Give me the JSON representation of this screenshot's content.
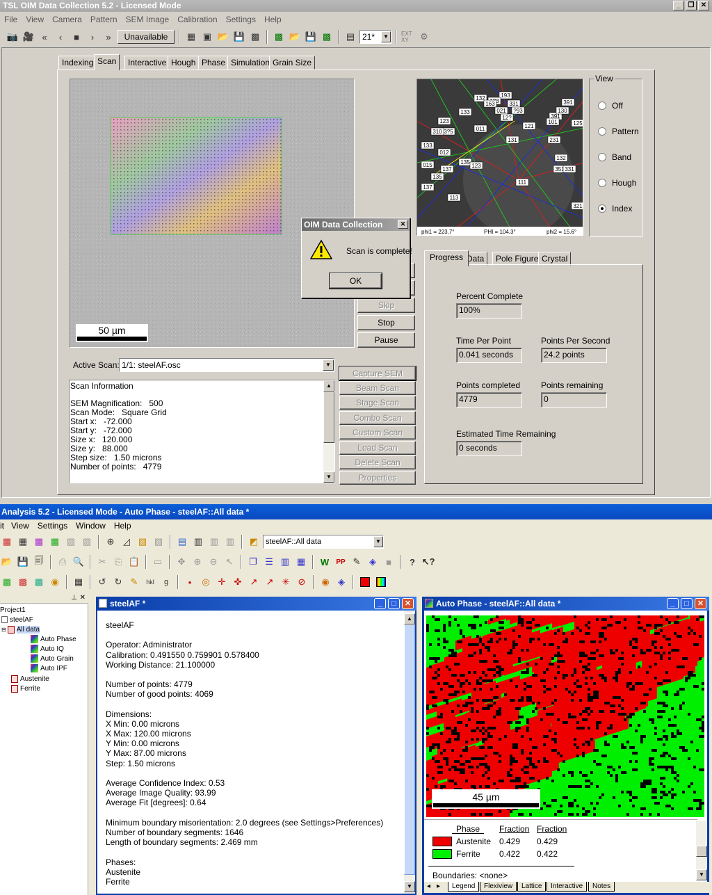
{
  "oim": {
    "title": "TSL OIM Data Collection 5.2 - Licensed Mode",
    "menu": [
      "File",
      "View",
      "Camera",
      "Pattern",
      "SEM Image",
      "Calibration",
      "Settings",
      "Help"
    ],
    "toolbar_status": "Unavailable",
    "zoom_value": "21*",
    "tabs": [
      "Indexing",
      "Scan",
      "Interactive",
      "Hough",
      "Phase",
      "Simulation",
      "Grain Size"
    ],
    "scale_bar": "50 µm",
    "view_group": {
      "title": "View",
      "options": [
        "Off",
        "Pattern",
        "Band",
        "Hough",
        "Index"
      ],
      "selected": "Index"
    },
    "pattern_footer": {
      "phi1": "phi1 = 223.7°",
      "PHI": "PHI = 104.3°",
      "phi2": "phi2 = 15.6°"
    },
    "pattern_labels": [
      "132",
      "193",
      "1?3",
      "331",
      "391",
      "133",
      "163",
      "021",
      "?93",
      "12?",
      "391",
      "123",
      "3?5",
      "130",
      "101",
      "125",
      "011",
      "133",
      "310",
      "121",
      "131",
      "132",
      "231",
      "137",
      "012",
      "135",
      "123",
      "351",
      "015",
      "137",
      "331",
      "135",
      "113",
      "111",
      "321"
    ],
    "dialog": {
      "title": "OIM Data Collection",
      "message": "Scan is complete!",
      "ok": "OK"
    },
    "scan_buttons": [
      "Skip",
      "Stop",
      "Pause"
    ],
    "active_scan_label": "Active Scan:",
    "active_scan_value": "1/1: steelAF.osc",
    "scan_info": {
      "heading": "Scan Information",
      "lines": [
        "SEM Magnification:   500",
        "Scan Mode:   Square Grid",
        "Start x:   -72.000",
        "Start y:   -72.000",
        "Size x:   120.000",
        "Size y:   88.000",
        "Step size:   1.50 microns",
        "Number of points:   4779"
      ]
    },
    "action_buttons": [
      "Capture SEM",
      "Beam Scan",
      "Stage Scan",
      "Combo Scan",
      "Custom Scan",
      "Load Scan",
      "Delete Scan",
      "Properties"
    ],
    "sub_tabs": [
      "Progress",
      "Data",
      "Pole Figure",
      "Crystal"
    ],
    "progress": {
      "percent_label": "Percent Complete",
      "percent_value": "100%",
      "tpp_label": "Time Per Point",
      "tpp_value": "0.041 seconds",
      "pps_label": "Points Per Second",
      "pps_value": "24.2 points",
      "done_label": "Points completed",
      "done_value": "4779",
      "remain_label": "Points remaining",
      "remain_value": "0",
      "eta_label": "Estimated Time Remaining",
      "eta_value": "0 seconds"
    }
  },
  "analysis": {
    "title": "Analysis 5.2 - Licensed Mode - Auto Phase - steelAF::All data *",
    "menu": [
      "it",
      "View",
      "Settings",
      "Window",
      "Help"
    ],
    "dataset_select": "steelAF::All data",
    "tree": {
      "project": "Project1",
      "dataset": "steelAF",
      "partition": "All data",
      "maps": [
        "Auto Phase",
        "Auto IQ",
        "Auto Grain",
        "Auto IPF"
      ],
      "phases": [
        "Austenite",
        "Ferrite"
      ]
    },
    "doc_window": {
      "title": "steelAF *",
      "lines": [
        "steelAF",
        "",
        "Operator: Administrator",
        "Calibration: 0.491550 0.759901 0.578400",
        "Working Distance: 21.100000",
        "",
        "Number of points: 4779",
        "Number of good points: 4069",
        "",
        "Dimensions:",
        "X Min: 0.00 microns",
        "X Max: 120.00 microns",
        "Y Min: 0.00 microns",
        "Y Max: 87.00 microns",
        "Step: 1.50 microns",
        "",
        "Average Confidence Index: 0.53",
        "Average Image Quality: 93.99",
        "Average Fit [degrees]: 0.64",
        "",
        "Minimum boundary misorientation: 2.0 degrees (see Settings>Preferences)",
        "Number of boundary segments: 1646",
        "Length of boundary segments: 2.469 mm",
        "",
        "Phases:",
        "Austenite",
        "Ferrite"
      ]
    },
    "map_window": {
      "title": "Auto Phase - steelAF::All data *",
      "scale_bar": "45 µm",
      "legend": {
        "headers": [
          "Phase",
          "Fraction",
          "Fraction"
        ],
        "rows": [
          {
            "phase": "Austenite",
            "f1": "0.429",
            "f2": "0.429",
            "color": "#ff0000"
          },
          {
            "phase": "Ferrite",
            "f1": "0.422",
            "f2": "0.422",
            "color": "#00ff00"
          }
        ],
        "boundaries": "Boundaries: <none>"
      },
      "bottom_tabs": [
        "Legend",
        "Flexiview",
        "Lattice",
        "Interactive",
        "Notes"
      ]
    }
  }
}
